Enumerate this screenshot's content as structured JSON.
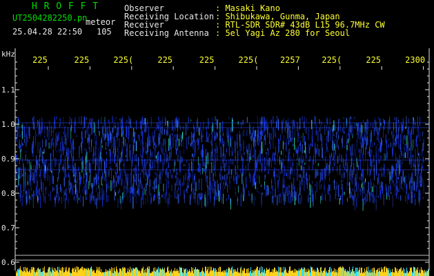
{
  "header": {
    "software": "H R O F F T",
    "filename": "UT2504282250.pn",
    "type_label": "meteor",
    "datetime": "25.04.28 22:50",
    "count": "105",
    "info": [
      {
        "label": "Observer",
        "value": ": Masaki Kano"
      },
      {
        "label": "Receiving Location",
        "value": ": Shibukawa, Gunma, Japan"
      },
      {
        "label": "Receiver",
        "value": ": RTL-SDR SDR# 43dB L15 96.7MHz CW"
      },
      {
        "label": "Receiving Antenna",
        "value": ": 5el Yagi Az 280 for Seoul"
      }
    ]
  },
  "axis": {
    "y_unit": "kHz",
    "y_ticks": [
      "1.1",
      "1.0",
      "0.9",
      "0.8",
      "0.7",
      "0.6"
    ],
    "x_ticks": [
      "225",
      "225",
      "225(",
      "225",
      "225",
      "225(",
      "2257",
      "225(",
      "225",
      "2300"
    ]
  },
  "colors": {
    "header_green": "#00e000",
    "label_yellow": "#ffff33",
    "axis_white": "#e8e8e8",
    "signal_blue": "#1a3cff",
    "signal_cyan": "#33ffd0"
  }
}
